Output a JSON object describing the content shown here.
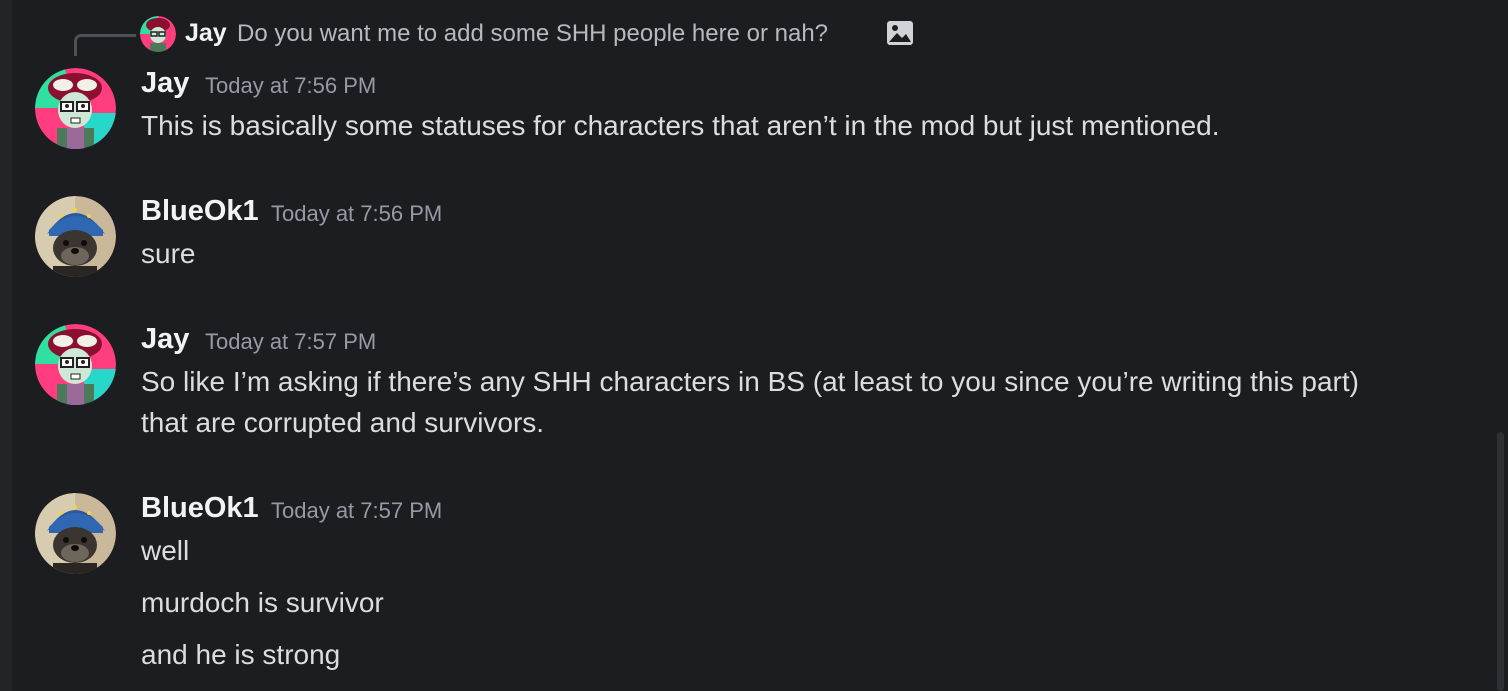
{
  "colors": {
    "background": "#1c1d21",
    "username": "#f2f3f5",
    "message_text": "#dbdee1",
    "timestamp": "#949ba4",
    "reply_text": "#b5bac1"
  },
  "reply": {
    "author": "Jay",
    "text": "Do you want me to add some SHH people here or nah?",
    "attachment_icon": "image-icon"
  },
  "messages": [
    {
      "author": "Jay",
      "timestamp": "Today at 7:56 PM",
      "avatar": "jay-avatar",
      "lines": [
        "This is basically some statuses for characters that aren’t in the mod but just mentioned."
      ]
    },
    {
      "author": "BlueOk1",
      "timestamp": "Today at 7:56 PM",
      "avatar": "blueok1-avatar",
      "lines": [
        "sure"
      ]
    },
    {
      "author": "Jay",
      "timestamp": "Today at 7:57 PM",
      "avatar": "jay-avatar",
      "lines": [
        "So like I’m asking if there’s any SHH characters in BS (at least to you since you’re writing this part)",
        "that are corrupted and survivors."
      ]
    },
    {
      "author": "BlueOk1",
      "timestamp": "Today at 7:57 PM",
      "avatar": "blueok1-avatar",
      "lines": [
        "well",
        "murdoch is survivor",
        "and he is strong"
      ]
    }
  ]
}
